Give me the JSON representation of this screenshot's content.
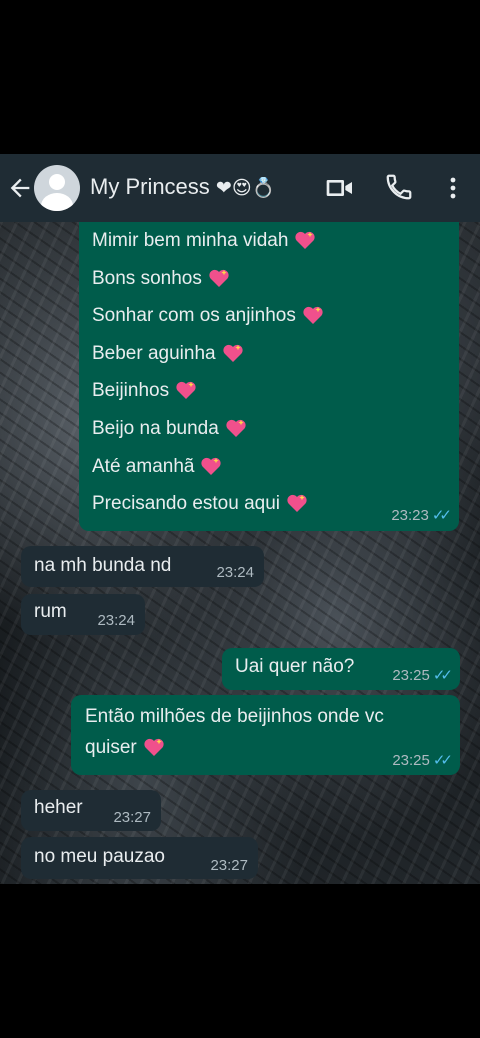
{
  "header": {
    "back_icon": "arrow-left-icon",
    "contact_name": "My Princess",
    "name_emojis": "❤😍💍",
    "video_icon": "video-call-icon",
    "call_icon": "phone-icon",
    "menu_icon": "more-vertical-icon"
  },
  "messages": [
    {
      "direction": "outgoing",
      "lines": [
        "Mimir bem minha vidah",
        "Bons sonhos",
        "Sonhar com os anjinhos",
        "Beber aguinha",
        "Beijinhos",
        "Beijo na bunda",
        "Até amanhã",
        "Precisando estou aqui"
      ],
      "time": "23:23",
      "status": "read"
    },
    {
      "direction": "incoming",
      "text": "na mh bunda nd",
      "time": "23:24"
    },
    {
      "direction": "incoming",
      "text": "rum",
      "time": "23:24"
    },
    {
      "direction": "outgoing",
      "text": "Uai quer não?",
      "time": "23:25",
      "status": "read"
    },
    {
      "direction": "outgoing",
      "lines": [
        "Então milhões de beijinhos onde vc",
        "quiser"
      ],
      "time": "23:25",
      "status": "read"
    },
    {
      "direction": "incoming",
      "text": "heher",
      "time": "23:27"
    },
    {
      "direction": "incoming",
      "text": "no meu pauzao",
      "time": "23:27"
    }
  ],
  "colors": {
    "header_bg": "#1f2c34",
    "outgoing_bubble": "#005c4b",
    "incoming_bubble": "#1f2c34",
    "read_ticks": "#53bdeb",
    "heart": "#f0508c"
  }
}
